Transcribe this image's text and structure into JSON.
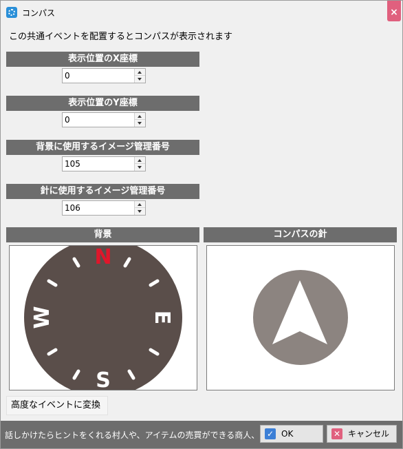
{
  "window": {
    "title": "コンパス",
    "close_glyph": "×"
  },
  "intro_text": "この共通イベントを配置するとコンパスが表示されます",
  "fields": [
    {
      "label": "表示位置のX座標",
      "value": "0"
    },
    {
      "label": "表示位置のY座標",
      "value": "0"
    },
    {
      "label": "背景に使用するイメージ管理番号",
      "value": "105"
    },
    {
      "label": "針に使用するイメージ管理番号",
      "value": "106"
    }
  ],
  "previews": {
    "background_label": "背景",
    "needle_label": "コンパスの針",
    "compass_letters": {
      "north": "N",
      "east": "E",
      "south": "S",
      "west": "W"
    },
    "colors": {
      "dial": "#5a4e4a",
      "north": "#e0162b",
      "needle_disc": "#8c8480"
    }
  },
  "convert_button": "高度なイベントに変換",
  "status": {
    "hint": "話しかけたらヒントをくれる村人や、アイテムの売買ができる商人、お金が",
    "ok": "OK",
    "cancel": "キャンセル"
  }
}
